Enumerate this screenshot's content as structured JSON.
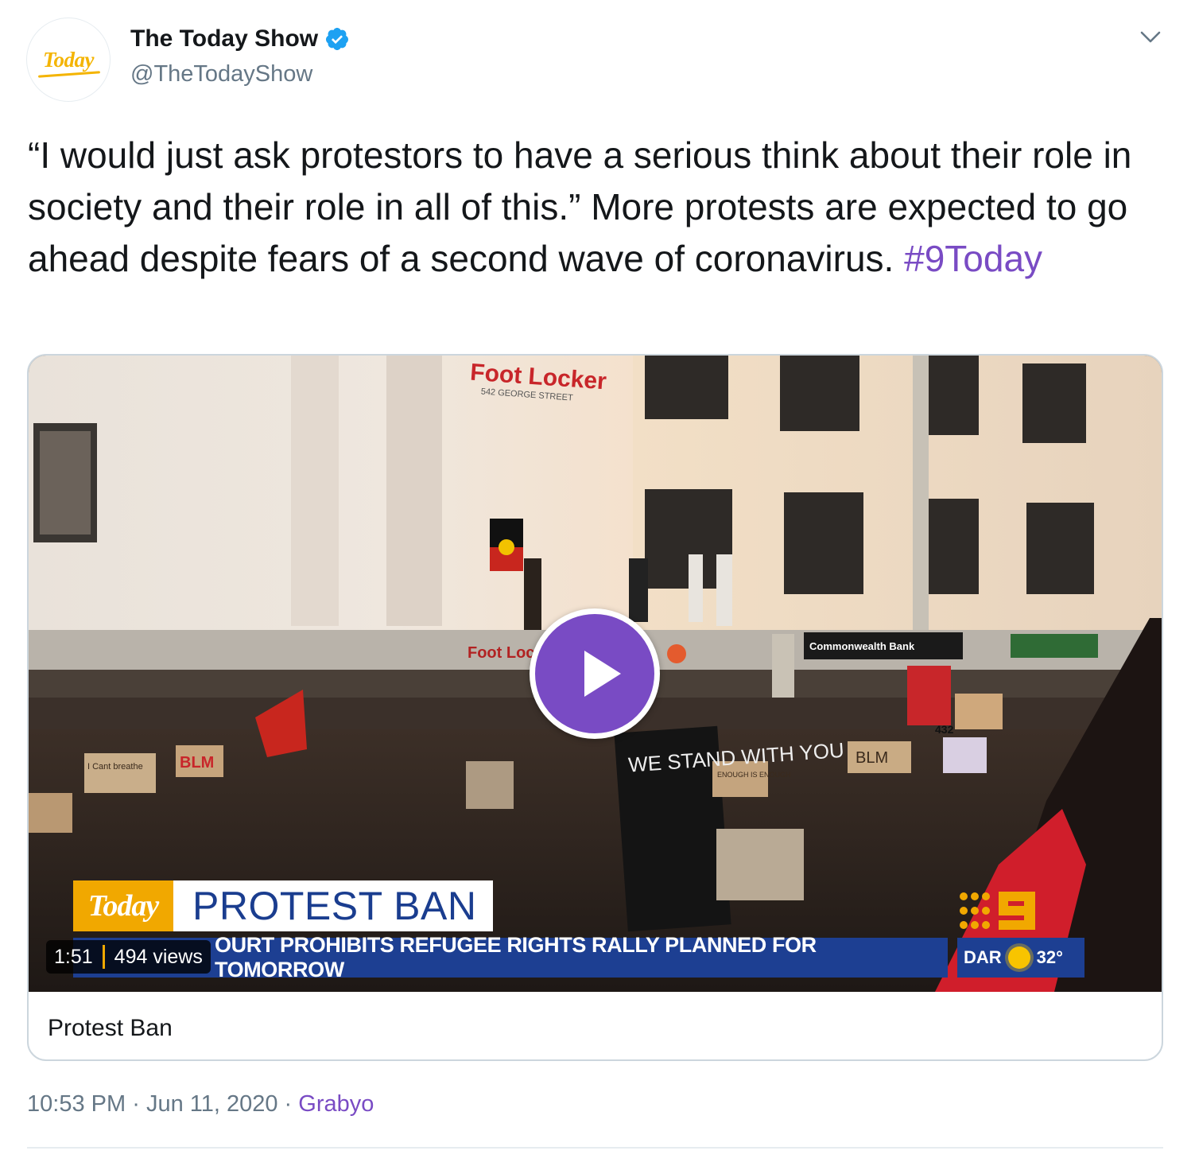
{
  "author": {
    "display_name": "The Today Show",
    "handle": "@TheTodayShow",
    "avatar_text": "Today",
    "verified": true
  },
  "tweet": {
    "text": "“I would just ask protestors to have a serious think about their role in society and their role in all of this.” More protests are expected to go ahead despite fears of a second wave of coronavirus. ",
    "hashtag": "#9Today"
  },
  "media": {
    "caption": "Protest Ban",
    "duration": "1:51",
    "views": "494 views",
    "overlay": {
      "tag": "Today",
      "headline": "PROTEST BAN",
      "ticker": "OURT PROHIBITS REFUGEE RIGHTS RALLY PLANNED FOR TOMORROW",
      "weather_city": "DAR",
      "weather_temp": "32°"
    },
    "scene_text": {
      "store_sign": "Foot Locker",
      "store_address": "542 GEORGE STREET",
      "store_awning": "Foot Loc",
      "bank_sign": "Commonwealth Bank",
      "placard_main": "WE STAND WITH YOU",
      "placard_blm": "BLM",
      "placard_blm2": "BLM",
      "placard_cant": "I Cant breathe",
      "placard_enough": "ENOUGH IS ENOUGH",
      "placard_432": "432"
    }
  },
  "footer": {
    "time": "10:53 PM",
    "separator": "·",
    "date": "Jun 11, 2020",
    "source": "Grabyo"
  },
  "colors": {
    "accent": "#794bc4",
    "verified": "#1da1f2",
    "muted_text": "#657786",
    "ticker_blue": "#1d3f92",
    "today_gold": "#f1a800"
  }
}
